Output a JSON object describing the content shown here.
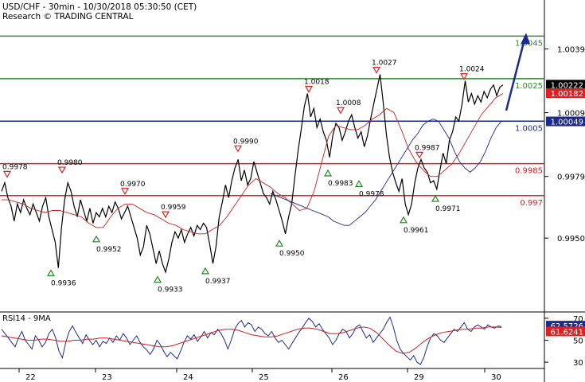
{
  "header": {
    "title": "USD/CHF - 30min - 10/30/2018 05:30:50 (CET)",
    "subtitle": "Research © TRADING CENTRAL"
  },
  "chart_data": [
    {
      "type": "line",
      "name": "price",
      "xlabel": "",
      "ylabel": "",
      "x_ticks": [
        "22",
        "23",
        "24",
        "25",
        "26",
        "29",
        "30"
      ],
      "y_ticks": [
        "1.0039",
        "1.0009",
        "0.9979",
        "0.9950"
      ],
      "ylim": [
        0.9916,
        1.0062
      ],
      "grid": false,
      "horizontal_levels": [
        {
          "value": 1.0045,
          "label": "1.0045",
          "color": "#2e8b2e"
        },
        {
          "value": 1.0025,
          "label": "1.0025",
          "color": "#2e8b2e"
        },
        {
          "value": 1.0005,
          "label": "1.0005",
          "color": "#1c2a8c"
        },
        {
          "value": 0.9985,
          "label": "0.9985",
          "color": "#e02020"
        },
        {
          "value": 0.997,
          "label": "0.997",
          "color": "#e02020"
        }
      ],
      "price_badges": [
        {
          "value": 1.00222,
          "label": "1.00222",
          "bg": "#000000",
          "fg": "#ffffff"
        },
        {
          "value": 1.00182,
          "label": "1.00182",
          "bg": "#e02020",
          "fg": "#ffffff"
        },
        {
          "value": 1.00049,
          "label": "1.00049",
          "bg": "#1c2a8c",
          "fg": "#ffffff"
        }
      ],
      "annotations": [
        {
          "label": "0.9978",
          "value": 0.9978,
          "kind": "high"
        },
        {
          "label": "0.9980",
          "value": 0.998,
          "kind": "high"
        },
        {
          "label": "0.9970",
          "value": 0.997,
          "kind": "high"
        },
        {
          "label": "0.9959",
          "value": 0.9959,
          "kind": "high"
        },
        {
          "label": "0.9990",
          "value": 0.999,
          "kind": "high"
        },
        {
          "label": "1.0018",
          "value": 1.0018,
          "kind": "high"
        },
        {
          "label": "1.0008",
          "value": 1.0008,
          "kind": "high"
        },
        {
          "label": "1.0027",
          "value": 1.0027,
          "kind": "high"
        },
        {
          "label": "0.9987",
          "value": 0.9987,
          "kind": "high"
        },
        {
          "label": "1.0024",
          "value": 1.0024,
          "kind": "high"
        },
        {
          "label": "0.9952",
          "value": 0.9952,
          "kind": "low"
        },
        {
          "label": "0.9936",
          "value": 0.9936,
          "kind": "low"
        },
        {
          "label": "0.9933",
          "value": 0.9933,
          "kind": "low"
        },
        {
          "label": "0.9937",
          "value": 0.9937,
          "kind": "low"
        },
        {
          "label": "0.9950",
          "value": 0.995,
          "kind": "low"
        },
        {
          "label": "0.9983",
          "value": 0.9983,
          "kind": "low"
        },
        {
          "label": "0.9978",
          "value": 0.9978,
          "kind": "low"
        },
        {
          "label": "0.9961",
          "value": 0.9961,
          "kind": "low"
        },
        {
          "label": "0.9971",
          "value": 0.9971,
          "kind": "low"
        }
      ],
      "series": [
        {
          "color": "#000000",
          "values": [
            0.9972,
            0.9976,
            0.9969,
            0.9965,
            0.9958,
            0.9966,
            0.9962,
            0.9968,
            0.9964,
            0.9961,
            0.9966,
            0.9962,
            0.9958,
            0.9965,
            0.9969,
            0.996,
            0.9954,
            0.9948,
            0.9936,
            0.9955,
            0.9968,
            0.9976,
            0.9972,
            0.9965,
            0.996,
            0.9968,
            0.9963,
            0.9958,
            0.9964,
            0.9957,
            0.9962,
            0.996,
            0.9964,
            0.996,
            0.9965,
            0.9962,
            0.9967,
            0.9964,
            0.9959,
            0.9962,
            0.9965,
            0.996,
            0.9955,
            0.995,
            0.9942,
            0.9946,
            0.9956,
            0.9952,
            0.9945,
            0.9938,
            0.9944,
            0.9938,
            0.9934,
            0.994,
            0.9948,
            0.9953,
            0.995,
            0.9954,
            0.9948,
            0.9952,
            0.9955,
            0.9951,
            0.9956,
            0.9954,
            0.9957,
            0.9955,
            0.9947,
            0.9938,
            0.9946,
            0.996,
            0.9967,
            0.9975,
            0.9969,
            0.9977,
            0.9983,
            0.9987,
            0.9977,
            0.9982,
            0.9975,
            0.9978,
            0.9986,
            0.9981,
            0.9976,
            0.9971,
            0.9969,
            0.9966,
            0.9972,
            0.9968,
            0.9963,
            0.9958,
            0.9952,
            0.996,
            0.9966,
            0.9979,
            0.9991,
            1.0001,
            1.0012,
            1.0018,
            1.0007,
            1.0011,
            1.0002,
            1.0006,
            1.0,
            0.9996,
            0.9988,
            0.9998,
            1.0004,
            1.0002,
            0.9996,
            1.0,
            1.0005,
            1.0008,
            1.0002,
            0.9997,
            1.0,
            0.9993,
            0.9998,
            1.0006,
            1.0013,
            1.002,
            1.0027,
            1.0014,
            0.9999,
            0.9988,
            0.9981,
            0.9976,
            0.9972,
            0.9978,
            0.9966,
            0.9961,
            0.9966,
            0.9976,
            0.9983,
            0.9987,
            0.9983,
            0.9981,
            0.9976,
            0.9977,
            0.9973,
            0.9982,
            0.999,
            0.9985,
            0.9996,
            1.0,
            1.0007,
            1.0005,
            1.0013,
            1.0024,
            1.0014,
            1.0018,
            1.0013,
            1.0017,
            1.0014,
            1.0019,
            1.0016,
            1.002,
            1.0022,
            1.0017,
            1.0021,
            1.0022
          ]
        },
        {
          "color": "#cc2020",
          "values": [
            0.9968,
            0.9968,
            0.9967,
            0.9966,
            0.9964,
            0.9963,
            0.9962,
            0.9963,
            0.9963,
            0.9962,
            0.9961,
            0.996,
            0.9957,
            0.9955,
            0.9955,
            0.996,
            0.9964,
            0.9966,
            0.9966,
            0.9964,
            0.9962,
            0.9961,
            0.9959,
            0.9957,
            0.9956,
            0.9954,
            0.9953,
            0.9952,
            0.9952,
            0.9954,
            0.9956,
            0.996,
            0.9965,
            0.997,
            0.9975,
            0.9978,
            0.9976,
            0.9974,
            0.9971,
            0.9969,
            0.9966,
            0.9963,
            0.9964,
            0.9972,
            0.9985,
            0.9998,
            1.0003,
            1.0002,
            1.0001,
            1.0001,
            1.0003,
            1.0006,
            1.0008,
            1.0011,
            1.0009,
            1.0001,
            0.9992,
            0.9986,
            0.9982,
            0.9979,
            0.9979,
            0.9982,
            0.9985,
            0.999,
            0.9996,
            1.0002,
            1.0008,
            1.0012,
            1.0016,
            1.0018
          ]
        },
        {
          "color": "#1c2a8c",
          "values": [
            0.9971,
            0.997,
            0.9969,
            0.9968,
            0.9967,
            0.9966,
            0.9965,
            0.9964,
            0.9963,
            0.9962,
            0.9961,
            0.996,
            0.9958,
            0.9957,
            0.9956,
            0.9956,
            0.9958,
            0.996,
            0.9962,
            0.9965,
            0.9968,
            0.9972,
            0.9976,
            0.998,
            0.9984,
            0.9988,
            0.9992,
            0.9996,
            0.9999,
            1.0003,
            1.0005,
            1.0006,
            1.0005,
            1.0001,
            0.9997,
            0.9991,
            0.9986,
            0.9983,
            0.9981,
            0.9983,
            0.9986,
            0.9991,
            0.9997,
            1.0002,
            1.0005
          ]
        }
      ],
      "forecast_arrow": [
        1.001,
        1.0045
      ]
    },
    {
      "type": "line",
      "name": "rsi",
      "title": "RSI14 - 9MA",
      "ylim": [
        25,
        75
      ],
      "y_ticks": [
        "70",
        "50",
        "30"
      ],
      "badges": [
        {
          "value": 62.5726,
          "label": "62.5726",
          "bg": "#1c2a8c",
          "fg": "#ffffff"
        },
        {
          "value": 61.6241,
          "label": "61.6241",
          "bg": "#e02020",
          "fg": "#ffffff"
        }
      ],
      "series": [
        {
          "color": "#1c2a8c",
          "values": [
            60,
            56,
            52,
            48,
            44,
            52,
            58,
            50,
            46,
            42,
            54,
            50,
            44,
            48,
            56,
            60,
            52,
            40,
            34,
            48,
            58,
            63,
            57,
            52,
            47,
            55,
            50,
            46,
            50,
            44,
            49,
            47,
            52,
            48,
            54,
            50,
            56,
            52,
            46,
            50,
            54,
            48,
            44,
            41,
            37,
            42,
            50,
            46,
            40,
            35,
            39,
            36,
            33,
            40,
            48,
            54,
            51,
            55,
            49,
            53,
            58,
            52,
            57,
            55,
            60,
            56,
            50,
            42,
            50,
            60,
            65,
            68,
            62,
            66,
            64,
            58,
            62,
            60,
            56,
            54,
            58,
            52,
            48,
            50,
            46,
            42,
            47,
            52,
            57,
            61,
            66,
            70,
            67,
            62,
            65,
            60,
            56,
            52,
            46,
            50,
            56,
            60,
            58,
            52,
            56,
            62,
            64,
            58,
            52,
            55,
            48,
            52,
            56,
            60,
            66,
            71,
            62,
            50,
            42,
            38,
            35,
            32,
            36,
            30,
            28,
            34,
            44,
            52,
            56,
            54,
            50,
            48,
            52,
            56,
            60,
            58,
            62,
            66,
            60,
            58,
            62,
            64,
            62,
            60,
            64,
            62,
            61,
            63,
            62.5
          ]
        },
        {
          "color": "#cc2020",
          "values": [
            54,
            53,
            52,
            51,
            50,
            50,
            51,
            51,
            50,
            49,
            49,
            50,
            50,
            51,
            51,
            52,
            52,
            51,
            50,
            49,
            48,
            47,
            46,
            45,
            44,
            44,
            45,
            47,
            49,
            51,
            53,
            55,
            57,
            59,
            60,
            60,
            59,
            57,
            55,
            54,
            53,
            53,
            54,
            56,
            58,
            60,
            61,
            61,
            60,
            58,
            56,
            56,
            57,
            59,
            61,
            62,
            61,
            57,
            51,
            45,
            40,
            38,
            39,
            43,
            48,
            52,
            55,
            57,
            58,
            59,
            60,
            60,
            61,
            61,
            62,
            62,
            61.6
          ]
        }
      ]
    }
  ]
}
